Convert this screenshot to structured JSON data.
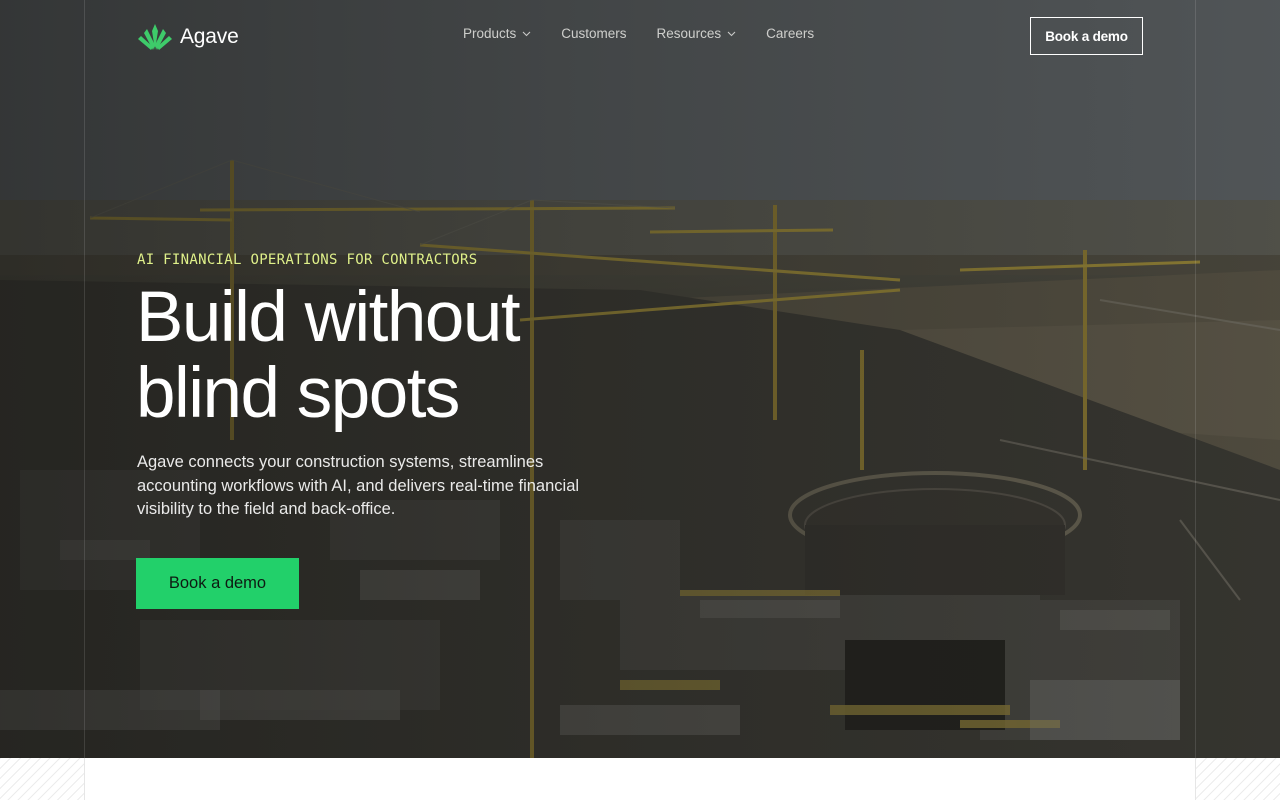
{
  "header": {
    "brand": "Agave",
    "nav": [
      {
        "label": "Products",
        "has_dropdown": true,
        "icon": "chevron-down-icon"
      },
      {
        "label": "Customers",
        "has_dropdown": false
      },
      {
        "label": "Resources",
        "has_dropdown": true,
        "icon": "chevron-down-icon"
      },
      {
        "label": "Careers",
        "has_dropdown": false
      }
    ],
    "cta_label": "Book a demo"
  },
  "hero": {
    "eyebrow": "AI FINANCIAL OPERATIONS FOR CONTRACTORS",
    "headline_line1": "Build without",
    "headline_line2": "blind spots",
    "subtext": "Agave connects your construction systems, streamlines accounting workflows with AI, and delivers real-time financial visibility to the field and back-office.",
    "cta_label": "Book a demo",
    "background_image": "construction-site-cranes-aerial"
  },
  "colors": {
    "accent_green": "#22d06a",
    "eyebrow_yellow": "#dff08a",
    "logo_green": "#3ecb6a"
  }
}
